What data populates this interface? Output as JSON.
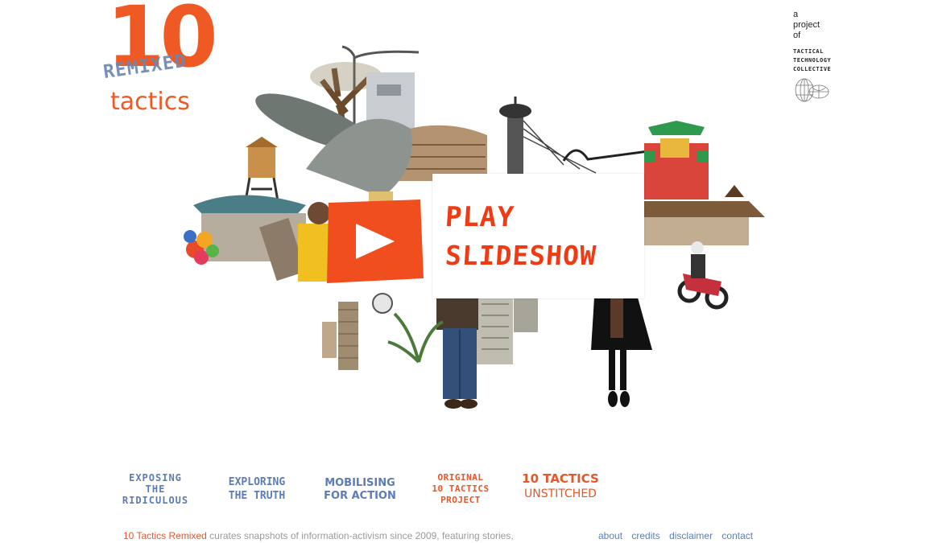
{
  "logo": {
    "number": "10",
    "remixed": "REMIXED",
    "tactics": "tactics"
  },
  "credit": {
    "line1": "a",
    "line2": "project",
    "line3": "of",
    "org1": "TACTICAL",
    "org2": "TECHNOLOGY",
    "org3": "COLLECTIVE"
  },
  "hero": {
    "play_line1": "PLAY",
    "play_line2": "SLIDESHOW"
  },
  "sections": {
    "exposing": {
      "l1": "EXPOSING",
      "l2": "THE",
      "l3": "RIDICULOUS"
    },
    "exploring": {
      "l1": "EXPLORING",
      "l2": "THE TRUTH"
    },
    "mobilising": {
      "l1": "MOBILISING",
      "l2": "FOR ACTION"
    },
    "original": {
      "l1": "ORIGINAL",
      "l2": "10 TACTICS",
      "l3": "PROJECT"
    },
    "unstitched": {
      "l1": "10 TACTICS",
      "l2": "UNSTITCHED"
    }
  },
  "footer": {
    "brand": "10 Tactics Remixed",
    "description": " curates snapshots of information-activism since 2009, featuring stories,",
    "links": {
      "about": "about",
      "credits": "credits",
      "disclaimer": "disclaimer",
      "contact": "contact"
    }
  },
  "colors": {
    "accent": "#ef5a24",
    "blue": "#5d7cb3",
    "link": "#5f7fb5",
    "muted": "#9a9a9a"
  }
}
